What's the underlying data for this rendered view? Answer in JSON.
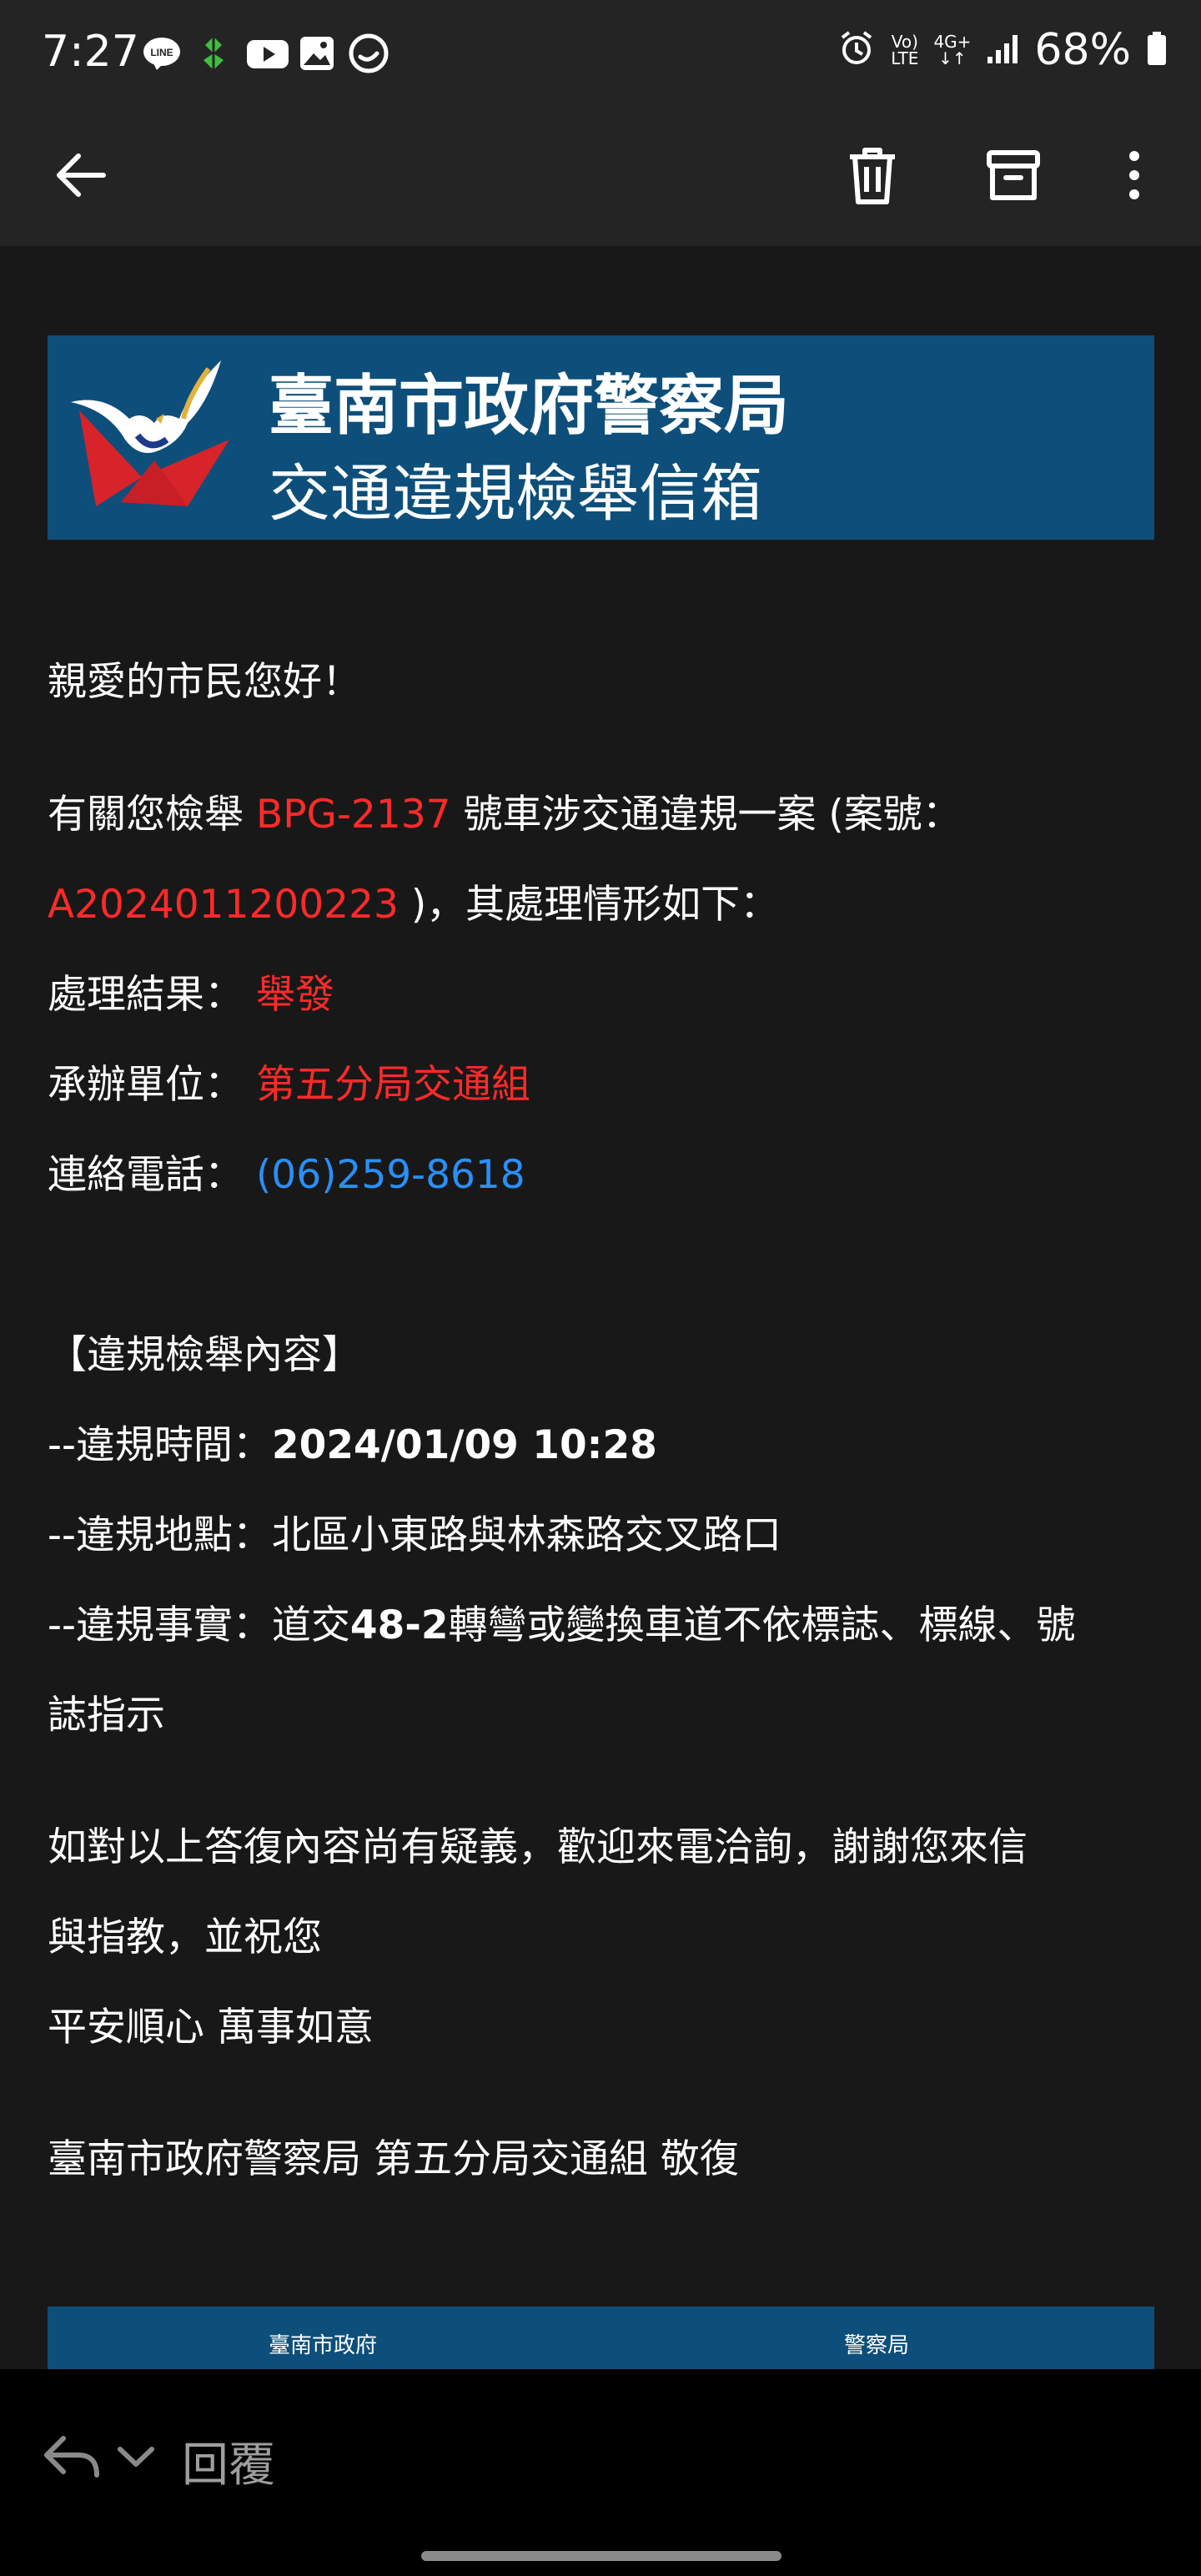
{
  "status_bar": {
    "time": "7:27",
    "battery": "68%",
    "network_top": "Vo)",
    "network_bottom": "LTE",
    "data_top": "4G+",
    "app_icons": [
      "line-icon",
      "leaf-app-icon",
      "youtube-icon",
      "gallery-icon",
      "messenger-icon"
    ]
  },
  "toolbar": {
    "back_icon": "arrow-left-icon",
    "actions": [
      "trash-icon",
      "archive-icon",
      "more-vert-icon"
    ]
  },
  "email": {
    "banner": {
      "title": "臺南市政府警察局",
      "subtitle": "交通違規檢舉信箱"
    },
    "greeting": "親愛的市民您好！",
    "intro_prefix": "有關您檢舉",
    "plate_number": "BPG-2137",
    "intro_middle": "號車涉交通違規一案 (案號：",
    "case_number": "A2024011200223",
    "intro_suffix": ")，其處理情形如下：",
    "result_label": "處理結果：",
    "result_value": "舉發",
    "unit_label": "承辦單位：",
    "unit_value": "第五分局交通組",
    "phone_label": "連絡電話：",
    "phone_value": "(06)259-8618",
    "section_title": "【違規檢舉內容】",
    "time_label": "--違規時間：",
    "time_value": "2024/01/09 10:28",
    "location_label": "--違規地點：",
    "location_value": "北區小東路與林森路交叉路口",
    "fact_label": "--違規事實：",
    "fact_prefix": "道交",
    "fact_code": "48-2",
    "fact_line1_rest": "轉彎或變換車道不依標誌、標線、號",
    "fact_line2": "誌指示",
    "closing_line1": "如對以上答復內容尚有疑義，歡迎來電洽詢，謝謝您來信",
    "closing_line2": "與指教，並祝您",
    "closing_line3": "平安順心 萬事如意",
    "signature": "臺南市政府警察局 第五分局交通組 敬復",
    "footer_left": "臺南市政府",
    "footer_right": "警察局"
  },
  "bottom_bar": {
    "reply_label": "回覆"
  },
  "colors": {
    "banner_bg": "#0d4f7a",
    "highlight_red": "#ff2a2a",
    "link_blue": "#2a8ff7"
  }
}
